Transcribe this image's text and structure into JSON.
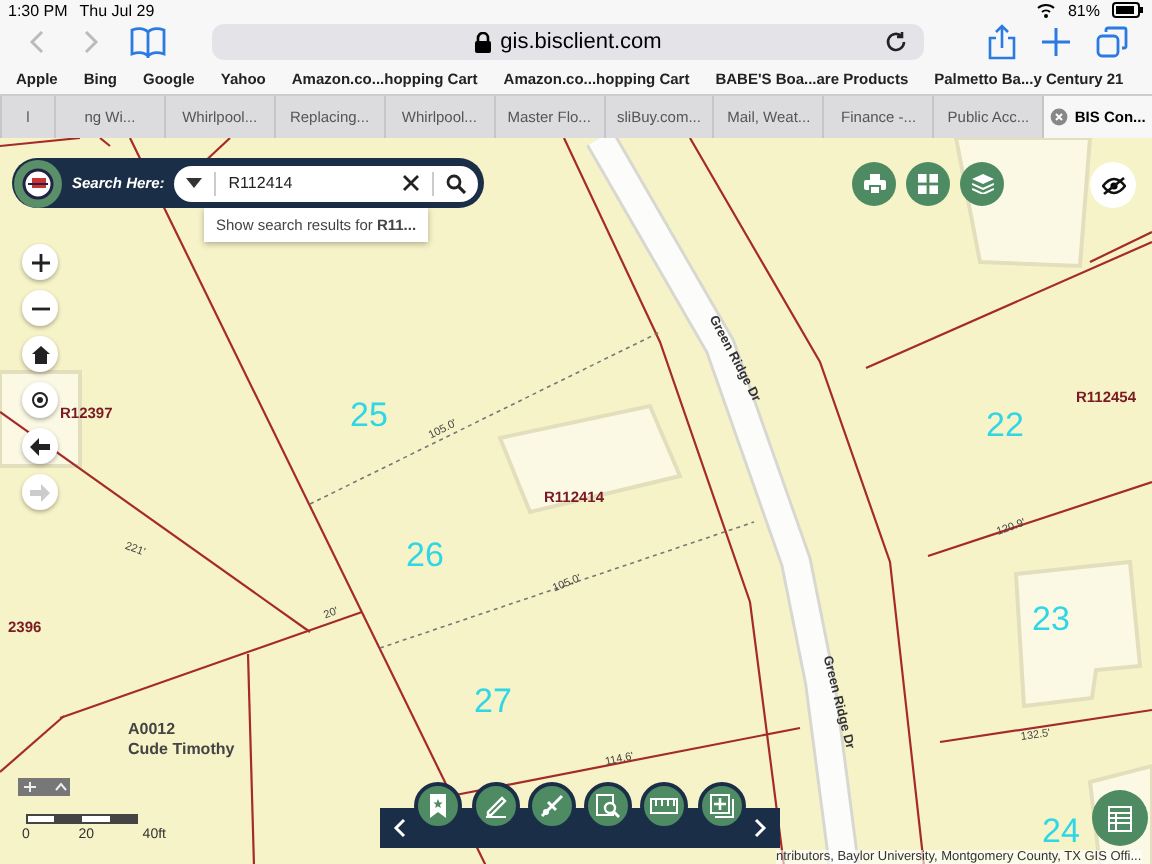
{
  "status_bar": {
    "time": "1:30 PM",
    "date": "Thu Jul 29",
    "battery": "81%"
  },
  "address_bar": {
    "url": "gis.bisclient.com"
  },
  "bookmarks": [
    "Apple",
    "Bing",
    "Google",
    "Yahoo",
    "Amazon.co...hopping Cart",
    "Amazon.co...hopping Cart",
    "BABE'S Boa...are Products",
    "Palmetto Ba...y Century 21"
  ],
  "tabs": [
    {
      "label": "l",
      "selected": false
    },
    {
      "label": "ng Wi...",
      "selected": false
    },
    {
      "label": "Whirlpool...",
      "selected": false
    },
    {
      "label": "Replacing...",
      "selected": false
    },
    {
      "label": "Whirlpool...",
      "selected": false
    },
    {
      "label": "Master Flo...",
      "selected": false
    },
    {
      "label": "sliBuy.com...",
      "selected": false
    },
    {
      "label": "Mail, Weat...",
      "selected": false
    },
    {
      "label": "Finance -...",
      "selected": false
    },
    {
      "label": "Public Acc...",
      "selected": false
    },
    {
      "label": "BIS Con...",
      "selected": true
    }
  ],
  "search": {
    "label": "Search Here:",
    "value": "R112414",
    "suggestion": "Show search results for **R11...**"
  },
  "map": {
    "parcel_numbers": [
      "25",
      "26",
      "27",
      "22",
      "23",
      "24"
    ],
    "owner_labels": [
      "R112414",
      "R112454",
      "R12397",
      "2396",
      "A0012",
      "Cude Timothy"
    ],
    "street_labels": [
      "Green Ridge Dr",
      "Green Ridge Dr"
    ],
    "dimension_labels": [
      "105.0'",
      "105.0'",
      "221'",
      "20'",
      "114.6'",
      "120.9'",
      "132.5'"
    ],
    "nav": {
      "forward_disabled": true
    },
    "scale": [
      "0",
      "20",
      "40ft"
    ],
    "attribution": "ntributors, Baylor University, Montgomery County, TX GIS Offi..."
  }
}
